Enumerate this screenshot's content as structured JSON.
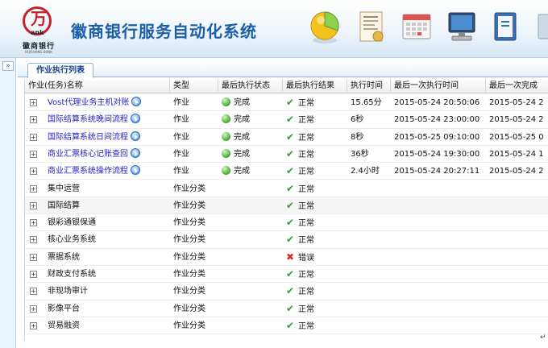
{
  "header": {
    "app_title": "徽商银行服务自动化系统",
    "logo_mark": "万",
    "logo_sub": "ank",
    "logo_name": "徽商银行",
    "logo_en": "HUISHANG BANK"
  },
  "side": {
    "expand_label": "»"
  },
  "tabs": [
    {
      "label": "作业执行列表"
    }
  ],
  "columns": [
    "作业(任务)名称",
    "类型",
    "最后执行状态",
    "最后执行结果",
    "执行时间",
    "最后一次执行时间",
    "最后一次完成"
  ],
  "rows": [
    {
      "name": "Vost代理业务主机对账",
      "type": "作业",
      "status": "完成",
      "result": "正常",
      "duration": "15.65分",
      "last_run": "2015-05-24 20:50:06",
      "last_done": "2015-05-24 2",
      "is_task": true,
      "result_kind": "ok"
    },
    {
      "name": "国际结算系统晚间流程",
      "type": "作业",
      "status": "完成",
      "result": "正常",
      "duration": "6秒",
      "last_run": "2015-05-24 23:00:00",
      "last_done": "2015-05-24 2",
      "is_task": true,
      "result_kind": "ok"
    },
    {
      "name": "国际结算系统日间流程",
      "type": "作业",
      "status": "完成",
      "result": "正常",
      "duration": "8秒",
      "last_run": "2015-05-25 09:10:00",
      "last_done": "2015-05-25 0",
      "is_task": false,
      "result_kind": "ok"
    },
    {
      "name": "商业汇票核心记账查回",
      "type": "作业",
      "status": "完成",
      "result": "正常",
      "duration": "36秒",
      "last_run": "2015-05-24 19:30:00",
      "last_done": "2015-05-24 1",
      "is_task": true,
      "result_kind": "ok"
    },
    {
      "name": "商业汇票系统操作流程",
      "type": "作业",
      "status": "完成",
      "result": "正常",
      "duration": "2.4小时",
      "last_run": "2015-05-24 20:27:11",
      "last_done": "2015-05-24 2",
      "is_task": true,
      "result_kind": "ok"
    },
    {
      "name": "集中运营",
      "type": "作业分类",
      "status": "",
      "result": "正常",
      "duration": "",
      "last_run": "",
      "last_done": "",
      "is_task": false,
      "result_kind": "ok"
    },
    {
      "name": "国际结算",
      "type": "作业分类",
      "status": "",
      "result": "正常",
      "duration": "",
      "last_run": "",
      "last_done": "",
      "is_task": false,
      "result_kind": "ok"
    },
    {
      "name": "银彩通银保通",
      "type": "作业分类",
      "status": "",
      "result": "正常",
      "duration": "",
      "last_run": "",
      "last_done": "",
      "is_task": false,
      "result_kind": "ok"
    },
    {
      "name": "核心业务系统",
      "type": "作业分类",
      "status": "",
      "result": "正常",
      "duration": "",
      "last_run": "",
      "last_done": "",
      "is_task": false,
      "result_kind": "ok"
    },
    {
      "name": "票据系统",
      "type": "作业分类",
      "status": "",
      "result": "错误",
      "duration": "",
      "last_run": "",
      "last_done": "",
      "is_task": false,
      "result_kind": "error"
    },
    {
      "name": "财政支付系统",
      "type": "作业分类",
      "status": "",
      "result": "正常",
      "duration": "",
      "last_run": "",
      "last_done": "",
      "is_task": false,
      "result_kind": "ok"
    },
    {
      "name": "非现场审计",
      "type": "作业分类",
      "status": "",
      "result": "正常",
      "duration": "",
      "last_run": "",
      "last_done": "",
      "is_task": false,
      "result_kind": "ok"
    },
    {
      "name": "影像平台",
      "type": "作业分类",
      "status": "",
      "result": "正常",
      "duration": "",
      "last_run": "",
      "last_done": "",
      "is_task": false,
      "result_kind": "ok"
    },
    {
      "name": "贸易融资",
      "type": "作业分类",
      "status": "",
      "result": "正常",
      "duration": "",
      "last_run": "",
      "last_done": "",
      "is_task": false,
      "result_kind": "ok"
    }
  ],
  "colors": {
    "title": "#1c5fa8",
    "task_link": "#2525c8",
    "ok": "#2e9d2a",
    "error": "#d12b2b"
  },
  "icons": {
    "expander": "plus-box-icon",
    "task_info": "play-circle-icon",
    "status": "green-dot-icon",
    "ok": "check-icon",
    "error": "cross-icon"
  },
  "footer": {
    "corner_mark": "↵"
  }
}
